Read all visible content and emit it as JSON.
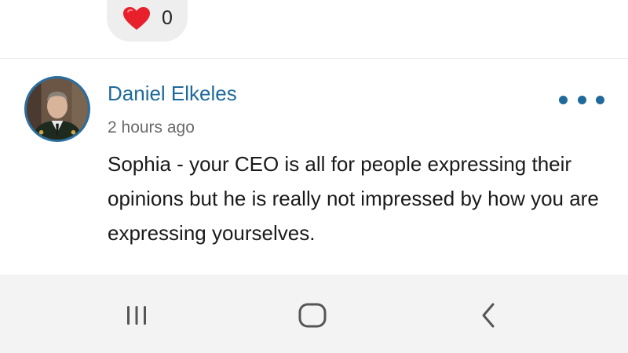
{
  "reaction": {
    "icon": "heart-icon",
    "icon_color": "#e8202b",
    "count": "0"
  },
  "comment": {
    "author": "Daniel Elkeles",
    "time": "2 hours ago",
    "text": "Sophia - your CEO is all for people expressing their opinions but he is really not impressed by how you are expressing yourselves.",
    "more_icon": "more-dots-icon",
    "accent_color": "#1f6a9b"
  },
  "navigation": {
    "recents_icon": "recents-icon",
    "home_icon": "home-icon",
    "back_icon": "back-icon"
  }
}
